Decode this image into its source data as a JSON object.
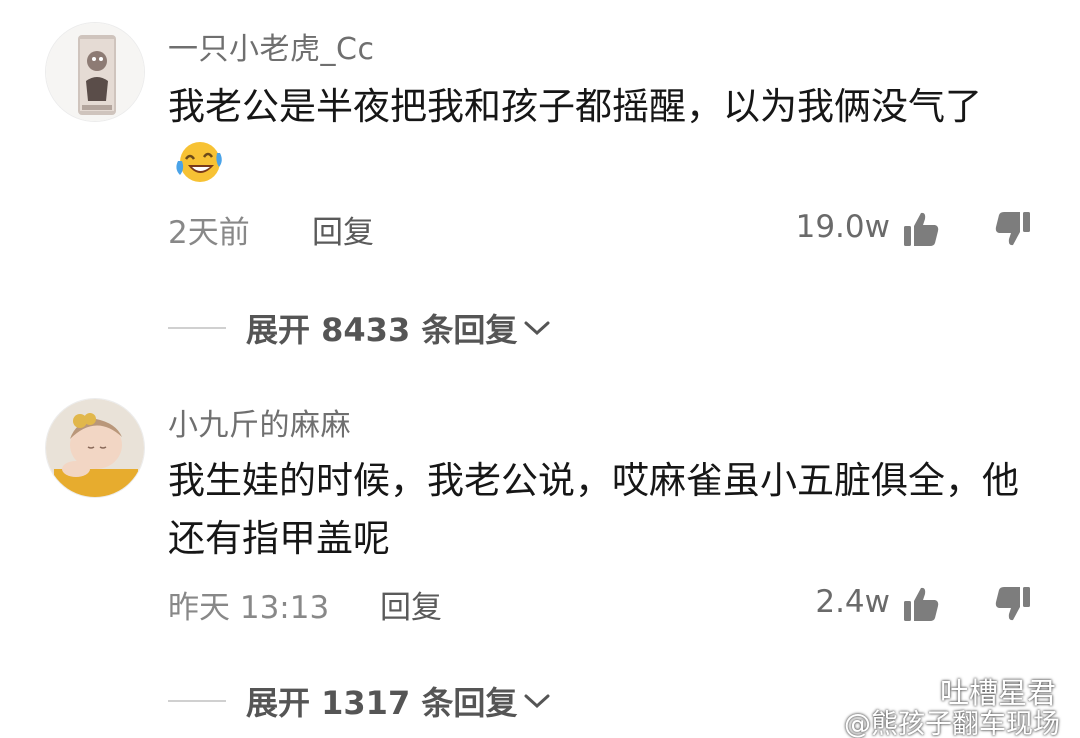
{
  "comments": [
    {
      "username": "一只小老虎_Cc",
      "content": "我老公是半夜把我和孩子都摇醒，以为我俩没气了",
      "time": "2天前",
      "reply_label": "回复",
      "likes": "19.0w",
      "expand_label": "展开 8433 条回复",
      "avatar_icon": "tiger-mug-avatar-icon",
      "emoji_icon": "laughing-tears-emoji-icon"
    },
    {
      "username": "小九斤的麻麻",
      "content": "我生娃的时候，我老公说，哎麻雀虽小五脏俱全，他还有指甲盖呢",
      "time": "昨天 13:13",
      "reply_label": "回复",
      "likes": "2.4w",
      "expand_label": "展开 1317 条回复",
      "avatar_icon": "baby-photo-avatar-icon"
    }
  ],
  "watermark": {
    "title": "吐槽星君",
    "handle": "@熊孩子翻车现场",
    "icons": [
      "wechat-icon",
      "weibo-icon"
    ]
  },
  "colors": {
    "username": "#6f6f6f",
    "content": "#161616",
    "meta": "#888888",
    "expand": "#555555"
  }
}
